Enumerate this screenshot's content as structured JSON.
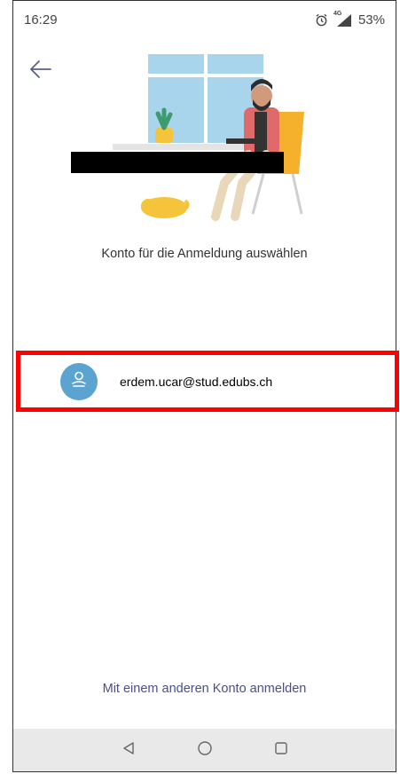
{
  "status_bar": {
    "time": "16:29",
    "network": "4G",
    "battery": "53%",
    "icons": [
      "alarm-icon",
      "signal-icon"
    ]
  },
  "header": {
    "back_icon": "arrow-left-icon"
  },
  "prompt_text": "Konto für die Anmeldung auswählen",
  "accounts": [
    {
      "email": "erdem.ucar@stud.edubs.ch",
      "avatar_icon": "person-icon",
      "avatar_color": "#5ba3d0"
    }
  ],
  "other_account_link": "Mit einem anderen Konto anmelden",
  "nav_bar": {
    "buttons": [
      "back-triangle-icon",
      "home-circle-icon",
      "recents-square-icon"
    ]
  },
  "colors": {
    "highlight_border": "#ff0000",
    "link_text": "#4a4f8a",
    "nav_background": "#e9e9e9"
  }
}
